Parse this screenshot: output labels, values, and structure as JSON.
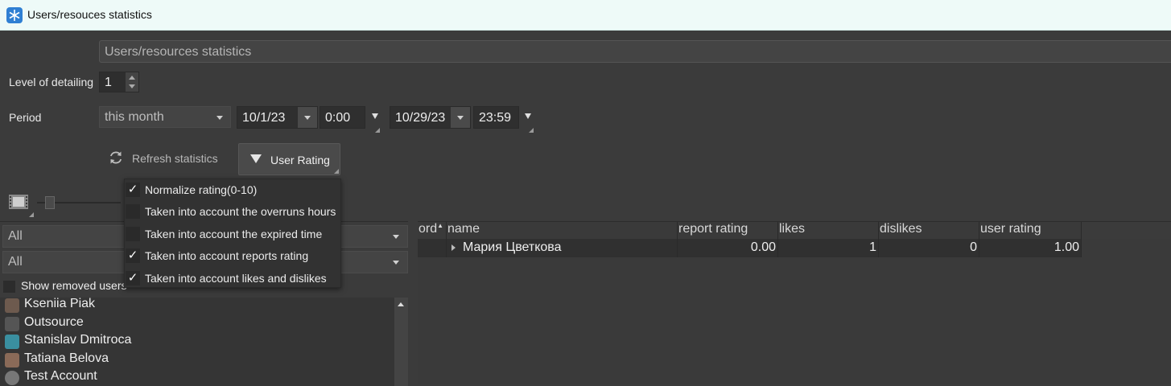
{
  "window": {
    "title": "Users/resouces statistics"
  },
  "report": {
    "name": "Users/resources statistics"
  },
  "level": {
    "label": "Level of detailing",
    "value": "1"
  },
  "period": {
    "label": "Period",
    "preset": "this month",
    "start_date": "10/1/23",
    "start_time": "0:00",
    "end_date": "10/29/23",
    "end_time": "23:59"
  },
  "toolbar": {
    "refresh_label": "Refresh statistics",
    "rating_label": "User Rating"
  },
  "rating_menu": {
    "items": [
      {
        "label": "Normalize rating(0-10)",
        "checked": true
      },
      {
        "label": "Taken into account the overruns hours",
        "checked": false
      },
      {
        "label": "Taken into account the expired time",
        "checked": false
      },
      {
        "label": "Taken into account reports rating",
        "checked": true
      },
      {
        "label": "Taken into account likes and dislikes",
        "checked": true
      }
    ]
  },
  "filters": {
    "filter1": "All",
    "filter2": "All",
    "show_removed_label": "Show removed users"
  },
  "users": [
    {
      "name": "Kseniia Piak",
      "avatar_color": "#6d5a4e"
    },
    {
      "name": "Outsource",
      "avatar_color": "#555555"
    },
    {
      "name": "Stanislav Dmitroca",
      "avatar_color": "#3a8fa0"
    },
    {
      "name": "Tatiana Belova",
      "avatar_color": "#8a6a58"
    },
    {
      "name": "Test Account",
      "avatar_color": "#777777"
    }
  ],
  "table": {
    "columns": [
      "ord",
      "name",
      "report rating",
      "likes",
      "dislikes",
      "user rating"
    ],
    "rows": [
      {
        "ord": "",
        "name": "Мария Цветкова",
        "report_rating": "0.00",
        "likes": "1",
        "dislikes": "0",
        "user_rating": "1.00"
      }
    ]
  },
  "icons": {
    "app": "snowflake-icon",
    "refresh": "refresh-icon",
    "rating": "triangle-down-icon",
    "film": "film-icon"
  }
}
